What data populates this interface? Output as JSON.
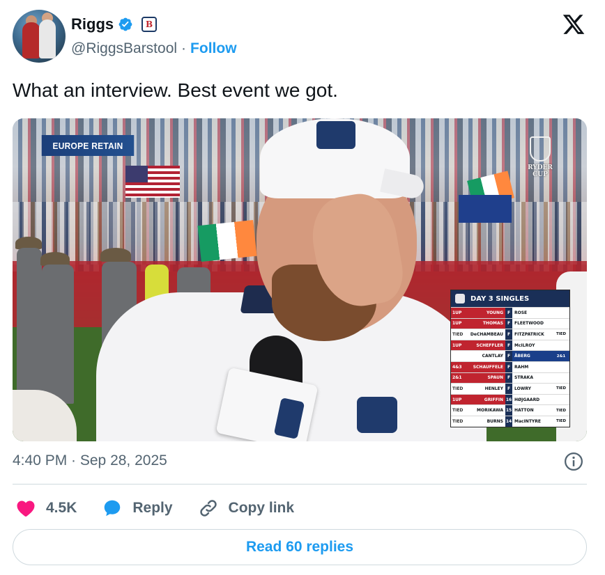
{
  "author": {
    "display_name": "Riggs",
    "handle": "@RiggsBarstool",
    "separator": "·",
    "follow_label": "Follow",
    "brand_badge_letter": "B",
    "verified_color": "#1d9bf0"
  },
  "tweet": {
    "text": "What an interview. Best event we got.",
    "timestamp": "4:40 PM · Sep 28, 2025"
  },
  "media": {
    "overlay_label": "EUROPE RETAIN",
    "ryder_cup_mark": "RYDER CUP",
    "scoreboard": {
      "title": "DAY 3 SINGLES",
      "rows": [
        {
          "status": "1UP",
          "us": "YOUNG",
          "hole": "F",
          "eu": "ROSE",
          "eu_status": "",
          "result": "us-win"
        },
        {
          "status": "1UP",
          "us": "THOMAS",
          "hole": "F",
          "eu": "FLEETWOOD",
          "eu_status": "",
          "result": "us-win"
        },
        {
          "status": "TIED",
          "us": "DeCHAMBEAU",
          "hole": "F",
          "eu": "FITZPATRICK",
          "eu_status": "TIED",
          "result": "tied"
        },
        {
          "status": "1UP",
          "us": "SCHEFFLER",
          "hole": "F",
          "eu": "McILROY",
          "eu_status": "",
          "result": "us-win"
        },
        {
          "status": "",
          "us": "CANTLAY",
          "hole": "F",
          "eu": "ÅBERG",
          "eu_status": "2&1",
          "result": "eu-win"
        },
        {
          "status": "4&3",
          "us": "SCHAUFFELE",
          "hole": "F",
          "eu": "RAHM",
          "eu_status": "",
          "result": "us-win"
        },
        {
          "status": "2&1",
          "us": "SPAUN",
          "hole": "F",
          "eu": "STRAKA",
          "eu_status": "",
          "result": "us-win"
        },
        {
          "status": "TIED",
          "us": "HENLEY",
          "hole": "F",
          "eu": "LOWRY",
          "eu_status": "TIED",
          "result": "tied"
        },
        {
          "status": "1UP",
          "us": "GRIFFIN",
          "hole": "16",
          "eu": "HØJGAARD",
          "eu_status": "",
          "result": "us-win"
        },
        {
          "status": "TIED",
          "us": "MORIKAWA",
          "hole": "15",
          "eu": "HATTON",
          "eu_status": "TIED",
          "result": "tied"
        },
        {
          "status": "TIED",
          "us": "BURNS",
          "hole": "14",
          "eu": "MacINTYRE",
          "eu_status": "TIED",
          "result": "tied"
        }
      ]
    }
  },
  "engagement": {
    "likes_count": "4.5K",
    "reply_label": "Reply",
    "copy_link_label": "Copy link",
    "read_replies_label": "Read 60 replies"
  },
  "icons": {
    "verified": "verified-badge-icon",
    "x_logo": "x-logo-icon",
    "info": "info-icon",
    "heart": "heart-icon",
    "reply": "reply-bubble-icon",
    "link": "link-icon"
  },
  "colors": {
    "accent": "#1d9bf0",
    "text_primary": "#0f1419",
    "text_secondary": "#536471",
    "heart": "#f91880",
    "us_red": "#c0242f",
    "eu_blue": "#1a3f8a"
  }
}
